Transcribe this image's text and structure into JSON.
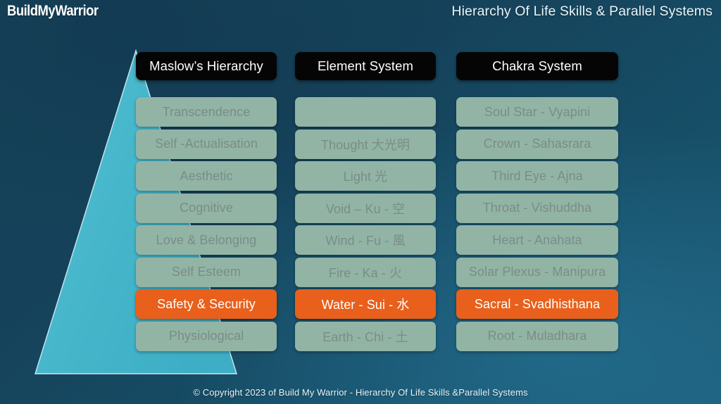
{
  "header": {
    "brand": "BuildMyWarrior",
    "title": "Hierarchy Of Life Skills & Parallel Systems"
  },
  "colors": {
    "background_dark": "#15425a",
    "background_light": "#1d5c78",
    "pyramid": "#4cbcd2",
    "row": "#92b4a5",
    "row_text": "#798d87",
    "highlight": "#e8601c",
    "highlight_text": "#ffffff",
    "header_chip": "#050505"
  },
  "columns": [
    {
      "heading": "Maslow’s Hierarchy",
      "rows": [
        {
          "label": "Transcendence",
          "highlighted": false
        },
        {
          "label": "Self -Actualisation",
          "highlighted": false
        },
        {
          "label": "Aesthetic",
          "highlighted": false
        },
        {
          "label": "Cognitive",
          "highlighted": false
        },
        {
          "label": "Love & Belonging",
          "highlighted": false
        },
        {
          "label": "Self Esteem",
          "highlighted": false
        },
        {
          "label": "Safety & Security",
          "highlighted": true
        },
        {
          "label": "Physiological",
          "highlighted": false
        }
      ]
    },
    {
      "heading": "Element System",
      "rows": [
        {
          "label": "",
          "highlighted": false
        },
        {
          "label": "Thought 大光明",
          "highlighted": false
        },
        {
          "label": "Light 光",
          "highlighted": false
        },
        {
          "label": "Void – Ku - 空",
          "highlighted": false
        },
        {
          "label": "Wind - Fu - 風",
          "highlighted": false
        },
        {
          "label": "Fire - Ka - 火",
          "highlighted": false
        },
        {
          "label": "Water - Sui - 水",
          "highlighted": true
        },
        {
          "label": "Earth - Chi - 土",
          "highlighted": false
        }
      ]
    },
    {
      "heading": "Chakra System",
      "rows": [
        {
          "label": "Soul Star - Vyapini",
          "highlighted": false
        },
        {
          "label": "Crown - Sahasrara",
          "highlighted": false
        },
        {
          "label": "Third Eye - Ajna",
          "highlighted": false
        },
        {
          "label": "Throat - Vishuddha",
          "highlighted": false
        },
        {
          "label": "Heart - Anahata",
          "highlighted": false
        },
        {
          "label": "Solar Plexus - Manipura",
          "highlighted": false
        },
        {
          "label": "Sacral - Svadhisthana",
          "highlighted": true
        },
        {
          "label": "Root - Muladhara",
          "highlighted": false
        }
      ]
    }
  ],
  "footer": {
    "copyright": "© Copyright 2023 of Build My Warrior - Hierarchy Of Life Skills &Parallel Systems"
  }
}
